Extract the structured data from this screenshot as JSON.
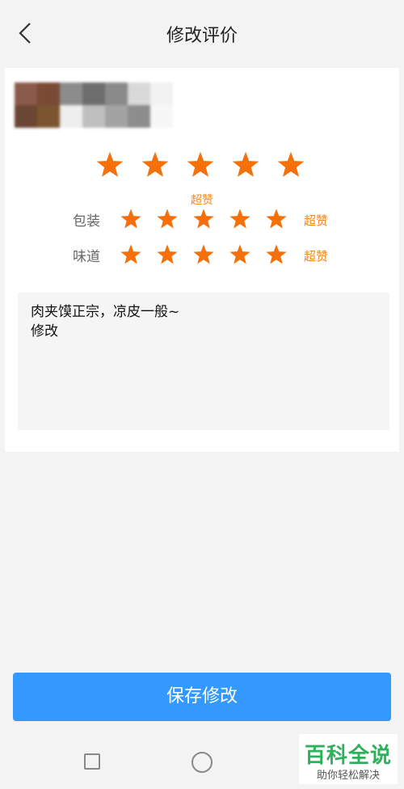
{
  "header": {
    "title": "修改评价",
    "back_icon": "chevron-left-icon"
  },
  "rating": {
    "star_color": "#f56f0a",
    "overall": {
      "value": 5,
      "max": 5,
      "label": "超赞"
    },
    "sub_ratings": [
      {
        "name": "包装",
        "value": 5,
        "max": 5,
        "label": "超赞"
      },
      {
        "name": "味道",
        "value": 5,
        "max": 5,
        "label": "超赞"
      }
    ]
  },
  "comment": {
    "line1": "肉夹馍正宗，凉皮一般~",
    "line2": "修改"
  },
  "actions": {
    "save_label": "保存修改",
    "accent_color": "#3399ff"
  },
  "nav": {
    "recent_icon": "square-icon",
    "home_icon": "circle-icon"
  },
  "watermark": {
    "title": "百科全说",
    "subtitle": "助你轻松解决"
  }
}
